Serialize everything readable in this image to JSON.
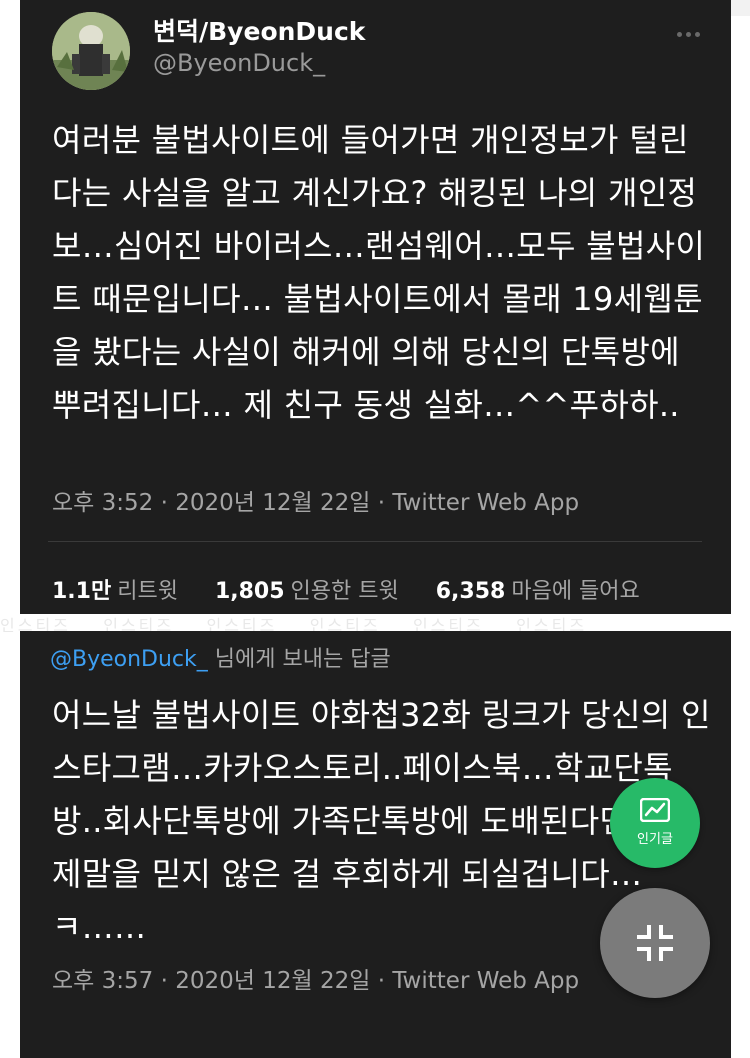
{
  "tweet": {
    "display_name": "변덕/ByeonDuck",
    "handle": "@ByeonDuck_",
    "text": "여러분 불법사이트에 들어가면 개인정보가 털린다는 사실을 알고 계신가요? 해킹된 나의 개인정보…심어진 바이러스…랜섬웨어…모두 불법사이트 때문입니다… 불법사이트에서 몰래 19세웹툰을 봤다는 사실이 해커에 의해 당신의 단톡방에 뿌려집니다… 제 친구 동생 실화…^^푸하하..",
    "meta": "오후 3:52 · 2020년 12월 22일 · Twitter Web App",
    "stats": {
      "retweets_count": "1.1만",
      "retweets_label": "리트윗",
      "quotes_count": "1,805",
      "quotes_label": "인용한 트윗",
      "likes_count": "6,358",
      "likes_label": "마음에 들어요"
    }
  },
  "reply": {
    "mention": "@ByeonDuck_",
    "reply_suffix": "님에게 보내는 답글",
    "text": "어느날 불법사이트 야화첩32화 링크가 당신의 인스타그램…카카오스토리..페이스북…학교단톡방..회사단톡방에 가족단톡방에 도배된다면…? 제말을 믿지 않은 걸 후회하게 되실겁니다…ㅋ……",
    "meta": "오후 3:57 · 2020년 12월 22일 · Twitter Web App"
  },
  "watermark": "인스티즈",
  "fab": {
    "popular_label": "인기글"
  },
  "icons": {
    "popular": "trending-chart-icon",
    "collapse": "collapse-icon",
    "more": "more-horizontal-icon"
  },
  "colors": {
    "card_bg": "#1e1e1e",
    "mention_blue": "#3d9ff2",
    "fab_green": "#27ba68",
    "fab_gray": "#7b7b7b"
  }
}
